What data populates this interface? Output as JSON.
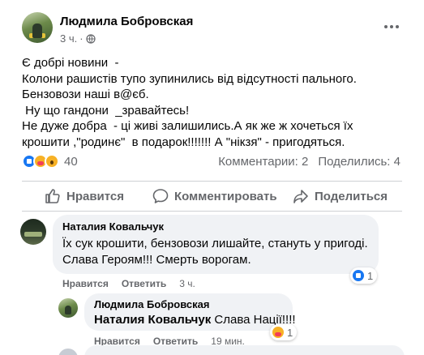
{
  "post": {
    "author": "Людмила Бобровская",
    "time": "3 ч.",
    "dot": "·",
    "lines": [
      "Є добрі новини  -",
      "Колони рашистів тупо зупинились від відсутності пального.",
      "Бензовози наші в@єб.",
      " Ну що гандони  _зравайтесь!",
      "Не дуже добра  - ці живі залишились.А як же ж хочеться їх",
      "крошити ,\"родинє\"  в подарок!!!!!!! А \"нікзя\" - пригодяться."
    ],
    "reaction_count": "40",
    "comments_count": "Комментарии: 2",
    "shares_count": "Поделились: 4"
  },
  "actions": {
    "like_label": "Нравится",
    "comment_label": "Комментировать",
    "share_label": "Поделиться"
  },
  "comments": [
    {
      "author": "Наталия Ковальчук",
      "lines": [
        "Їх сук крошити, бензовози лишайте, стануть у пригоді.",
        "Слава Героям!!! Смерть ворогам."
      ],
      "like_label": "Нравится",
      "reply_label": "Ответить",
      "time": "3 ч.",
      "reaction_count": "1"
    },
    {
      "author": "Людмила Бобровская",
      "mention": "Наталия Ковальчук",
      "text": " Слава Нації!!!!",
      "like_label": "Нравится",
      "reply_label": "Ответить",
      "time": "19 мин.",
      "reaction_count": "1"
    }
  ],
  "colors": {
    "like_blue": "#1877f2",
    "secondary_text": "#65676b",
    "bubble_bg": "#f0f2f5"
  },
  "icons": [
    "globe-icon",
    "more-options-icon",
    "thumbs-up-icon",
    "comment-icon",
    "share-icon"
  ]
}
